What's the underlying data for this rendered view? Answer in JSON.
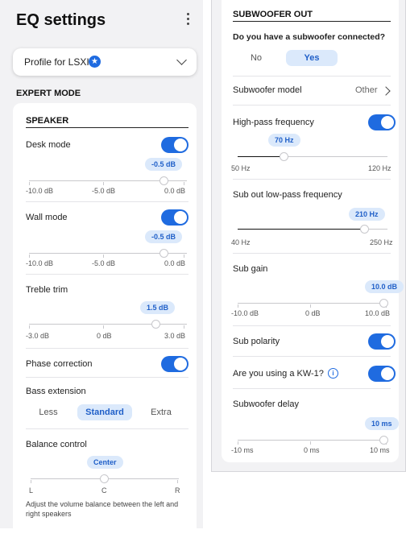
{
  "left": {
    "title": "EQ settings",
    "profile_label": "Profile for LSXII",
    "expert_mode": "EXPERT MODE",
    "speaker_section": "SPEAKER",
    "desk_mode": {
      "label": "Desk mode",
      "value": "-0.5 dB",
      "level": 0.95,
      "min": "-10.0 dB",
      "mid": "-5.0 dB",
      "max": "0.0 dB"
    },
    "wall_mode": {
      "label": "Wall mode",
      "value": "-0.5 dB",
      "level": 0.95,
      "min": "-10.0 dB",
      "mid": "-5.0 dB",
      "max": "0.0 dB"
    },
    "treble_trim": {
      "label": "Treble trim",
      "value": "1.5 dB",
      "level": 0.75,
      "min": "-3.0 dB",
      "mid": "0 dB",
      "max": "3.0 dB"
    },
    "phase_correction": "Phase correction",
    "bass_extension": {
      "label": "Bass extension",
      "options": [
        "Less",
        "Standard",
        "Extra"
      ],
      "selected": "Standard"
    },
    "balance": {
      "label": "Balance control",
      "value": "Center",
      "level": 0.5,
      "min": "L",
      "mid": "C",
      "max": "R",
      "help": "Adjust the volume balance between the left and right speakers"
    }
  },
  "right": {
    "section": "SUBWOOFER OUT",
    "question": "Do you have a subwoofer connected?",
    "options": [
      "No",
      "Yes"
    ],
    "selected": "Yes",
    "model_label": "Subwoofer model",
    "model_value": "Other",
    "high_pass": {
      "label": "High-pass frequency",
      "value": "70 Hz",
      "level": 0.29,
      "min": "50 Hz",
      "max": "120 Hz"
    },
    "low_pass": {
      "label": "Sub out low-pass frequency",
      "value": "210 Hz",
      "level": 0.81,
      "min": "40 Hz",
      "max": "250 Hz"
    },
    "sub_gain": {
      "label": "Sub gain",
      "value": "10.0 dB",
      "level": 1.0,
      "min": "-10.0 dB",
      "mid": "0 dB",
      "max": "10.0 dB"
    },
    "sub_polarity": "Sub polarity",
    "kw1": "Are you using a KW-1?",
    "delay": {
      "label": "Subwoofer delay",
      "value": "10 ms",
      "level": 1.0,
      "min": "-10 ms",
      "mid": "0 ms",
      "max": "10 ms"
    }
  },
  "colors": {
    "accent": "#1f6be0",
    "pill_bg": "#dbe9fb",
    "panel_bg": "#f2f2f4"
  }
}
